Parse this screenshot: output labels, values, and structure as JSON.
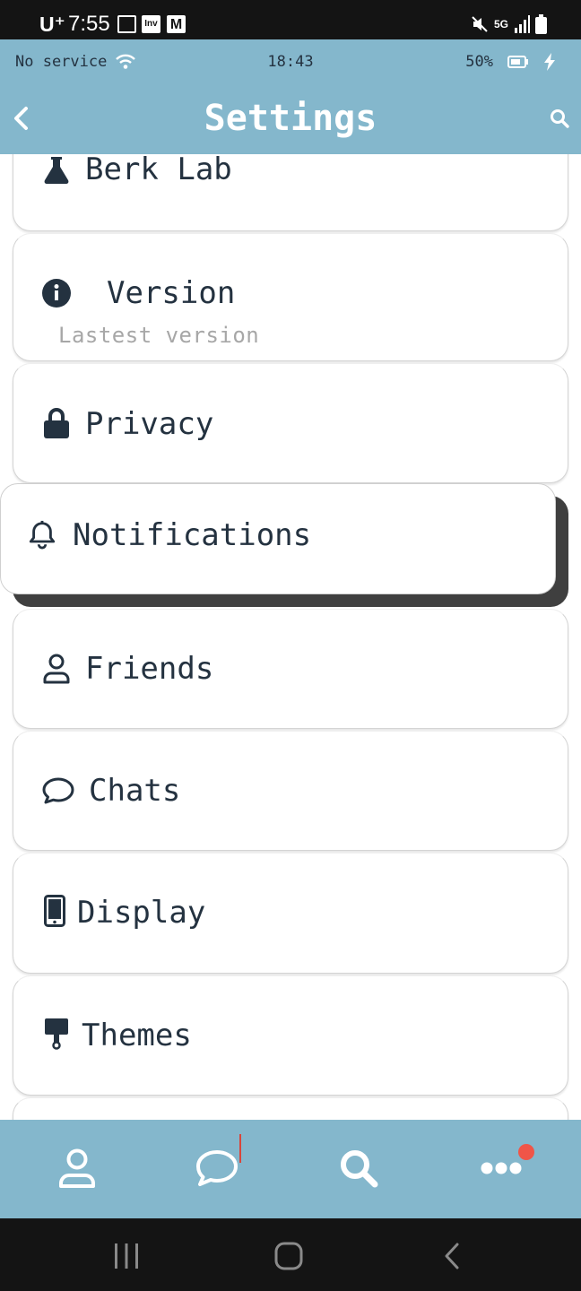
{
  "system_bar": {
    "carrier": "U⁺",
    "time": "7:55",
    "icons": [
      "gallery-icon",
      "inv-app-icon",
      "mail-icon",
      "mute-icon",
      "5g-icon",
      "signal-icon",
      "battery-icon"
    ],
    "inv_label": "Inv",
    "mail_label": "M",
    "network": "5G"
  },
  "app_status": {
    "service": "No service",
    "time": "18:43",
    "battery": "50%"
  },
  "header": {
    "title": "Settings",
    "back_icon": "chevron-left-icon",
    "search_icon": "search-icon"
  },
  "settings": {
    "items": [
      {
        "label": "Berk Lab",
        "icon": "flask-icon"
      },
      {
        "label": "Version",
        "sublabel": "Lastest version",
        "icon": "info-icon"
      },
      {
        "label": "Privacy",
        "icon": "lock-icon"
      },
      {
        "label": "Notifications",
        "icon": "bell-icon"
      },
      {
        "label": "Friends",
        "icon": "user-icon"
      },
      {
        "label": "Chats",
        "icon": "chat-bubble-icon"
      },
      {
        "label": "Display",
        "icon": "phone-icon"
      },
      {
        "label": "Themes",
        "icon": "paint-roller-icon"
      }
    ]
  },
  "bottom_nav": {
    "items": [
      "profile-icon",
      "chat-icon",
      "search-icon",
      "more-icon"
    ],
    "colors": {
      "background": "#84b7cc",
      "badge": "#f05548"
    }
  },
  "colors": {
    "accent": "#84b7cc",
    "text": "#243240",
    "muted": "#a7a7a7",
    "shadow": "#3f3f3f"
  }
}
